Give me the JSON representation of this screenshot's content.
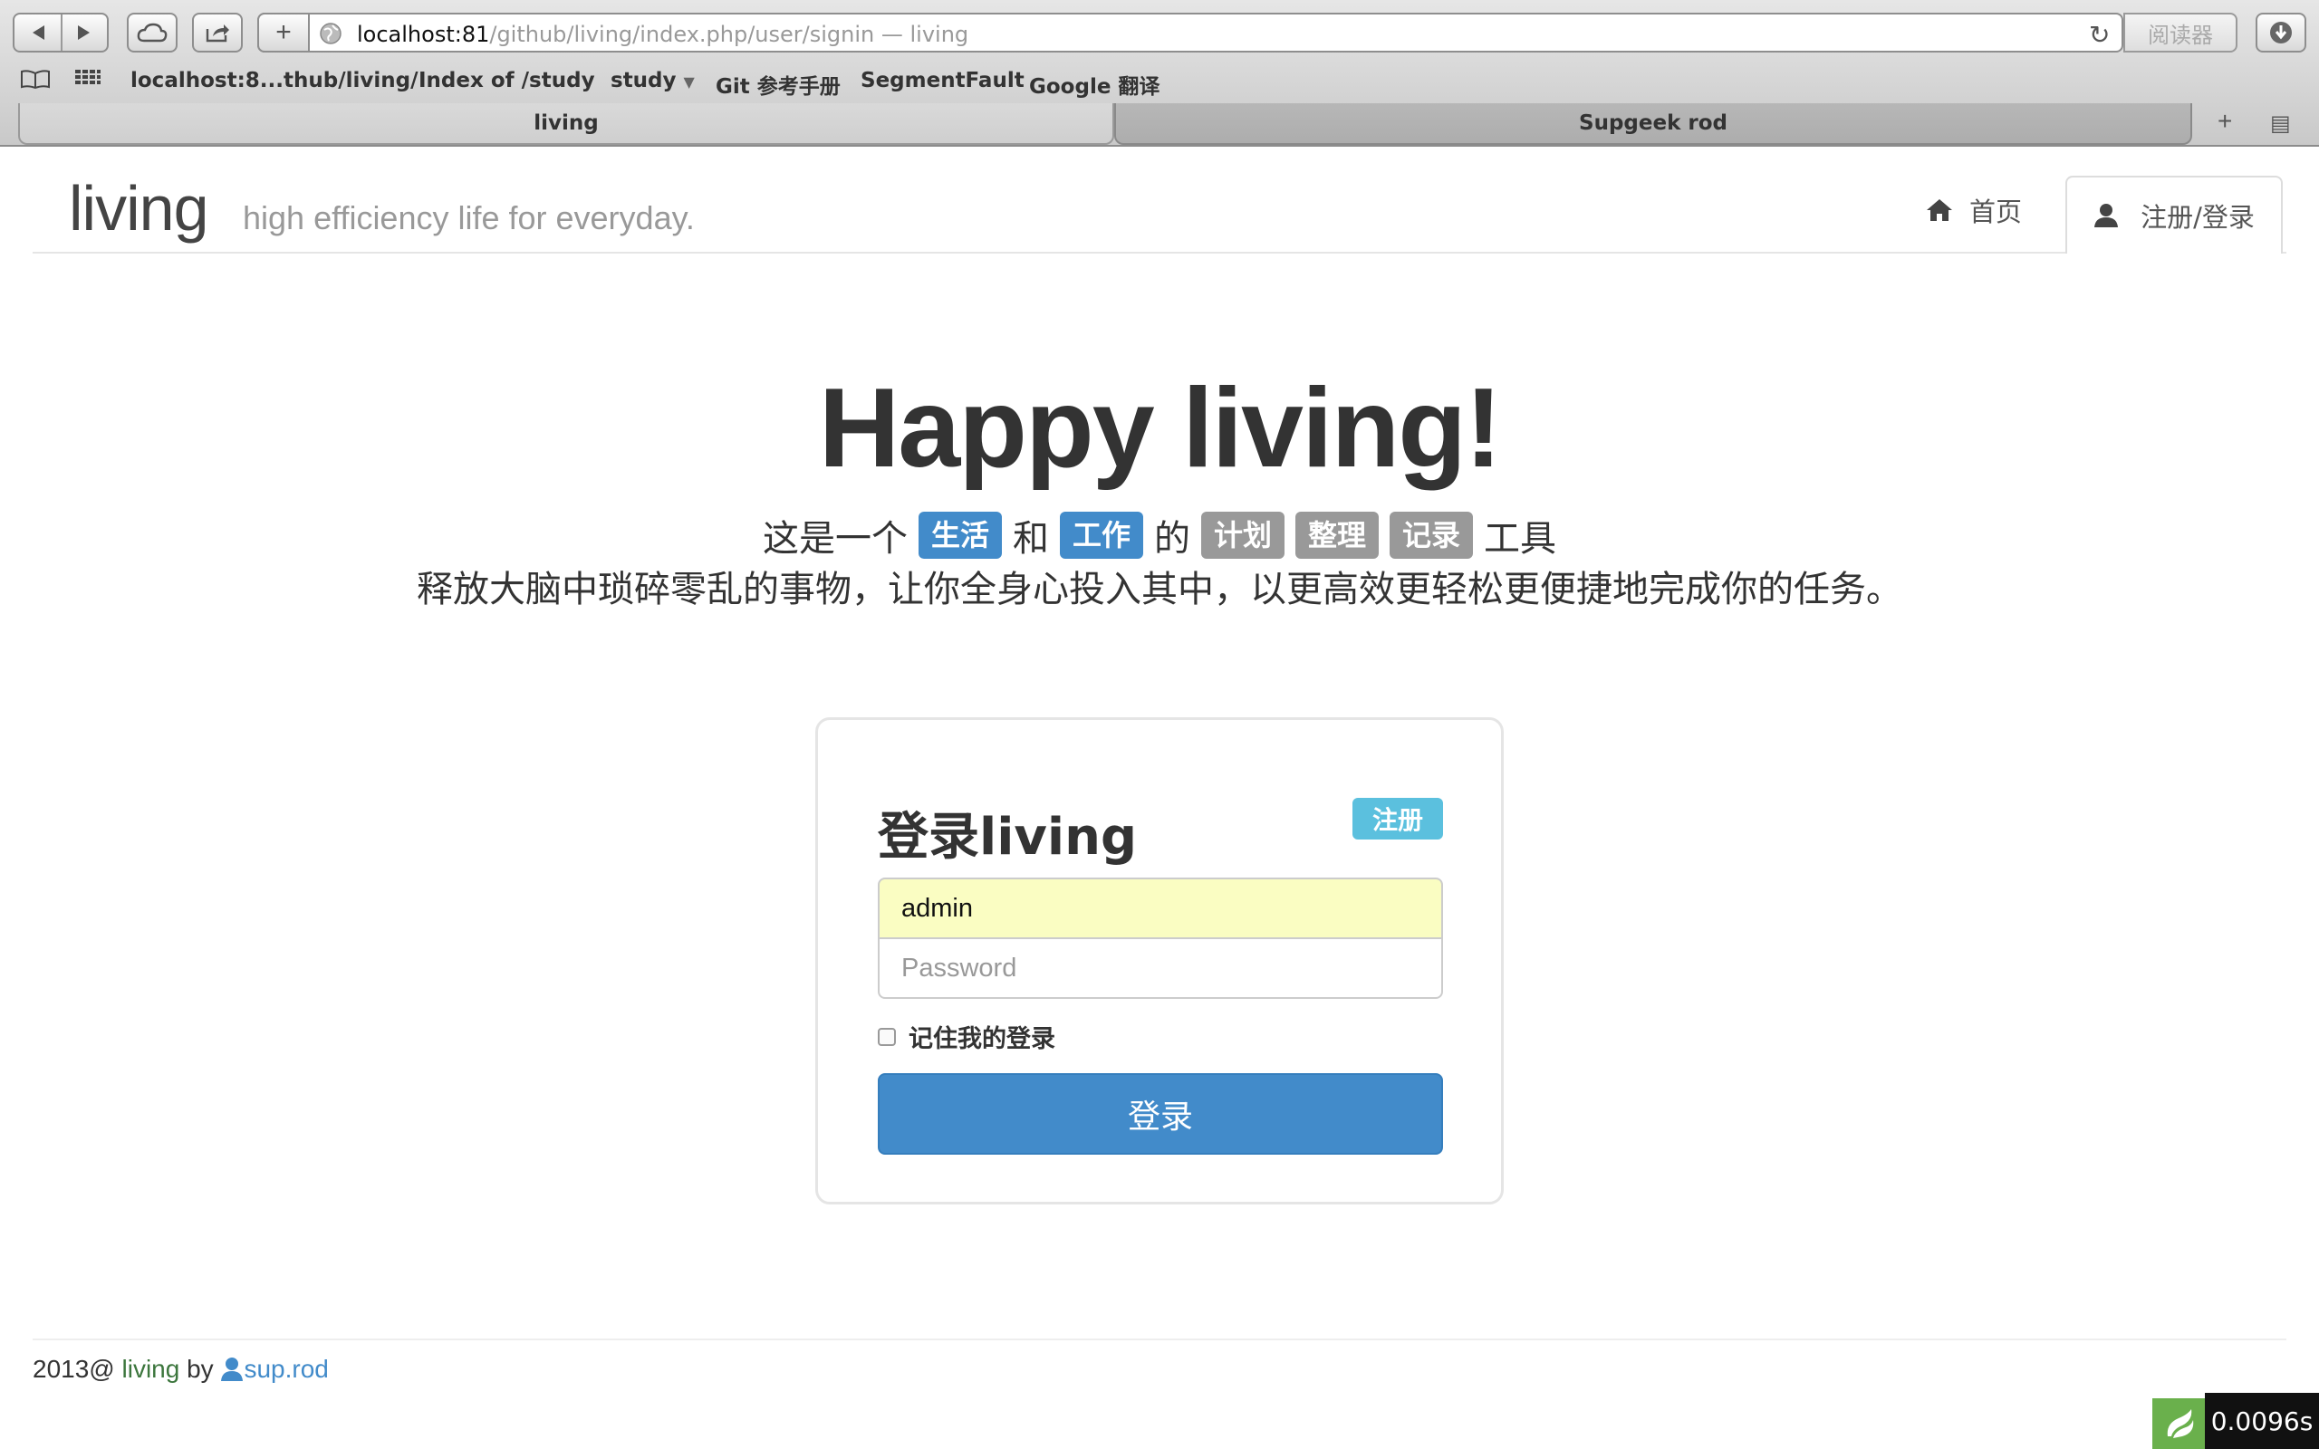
{
  "browser": {
    "url_host": "localhost:81",
    "url_path": "/github/living/index.php/user/signin",
    "url_suffix": " — living",
    "reader_label": "阅读器",
    "bookmarks": [
      "localhost:8...thub/living/",
      "Index of /study",
      "study",
      "Git 参考手册",
      "SegmentFault",
      "Google 翻译"
    ],
    "tabs": [
      {
        "label": "living",
        "active": true
      },
      {
        "label": "Supgeek rod",
        "active": false
      }
    ]
  },
  "navbar": {
    "brand": "living",
    "tagline": "high efficiency life for everyday.",
    "home_label": "首页",
    "login_label": "注册/登录"
  },
  "hero": {
    "title": "Happy living!",
    "line1_prefix": "这是一个",
    "label_life": "生活",
    "and": "和",
    "label_work": "工作",
    "of": "的",
    "label_plan": "计划",
    "label_organize": "整理",
    "label_record": "记录",
    "line1_suffix": "工具",
    "line2": "释放大脑中琐碎零乱的事物，让你全身心投入其中，以更高效更轻松更便捷地完成你的任务。"
  },
  "login": {
    "title": "登录living",
    "register_label": "注册",
    "username_value": "admin",
    "password_placeholder": "Password",
    "remember_label": "记住我的登录",
    "remember_checked": false,
    "submit_label": "登录"
  },
  "footer": {
    "year_prefix": "2013@",
    "site": "living",
    "by": "by",
    "author": "sup.rod"
  },
  "debug": {
    "timer": "0.0096s"
  },
  "colors": {
    "primary": "#428bca",
    "info": "#5bc0de",
    "label_gray": "#999999",
    "autofill": "#fafdc2"
  }
}
